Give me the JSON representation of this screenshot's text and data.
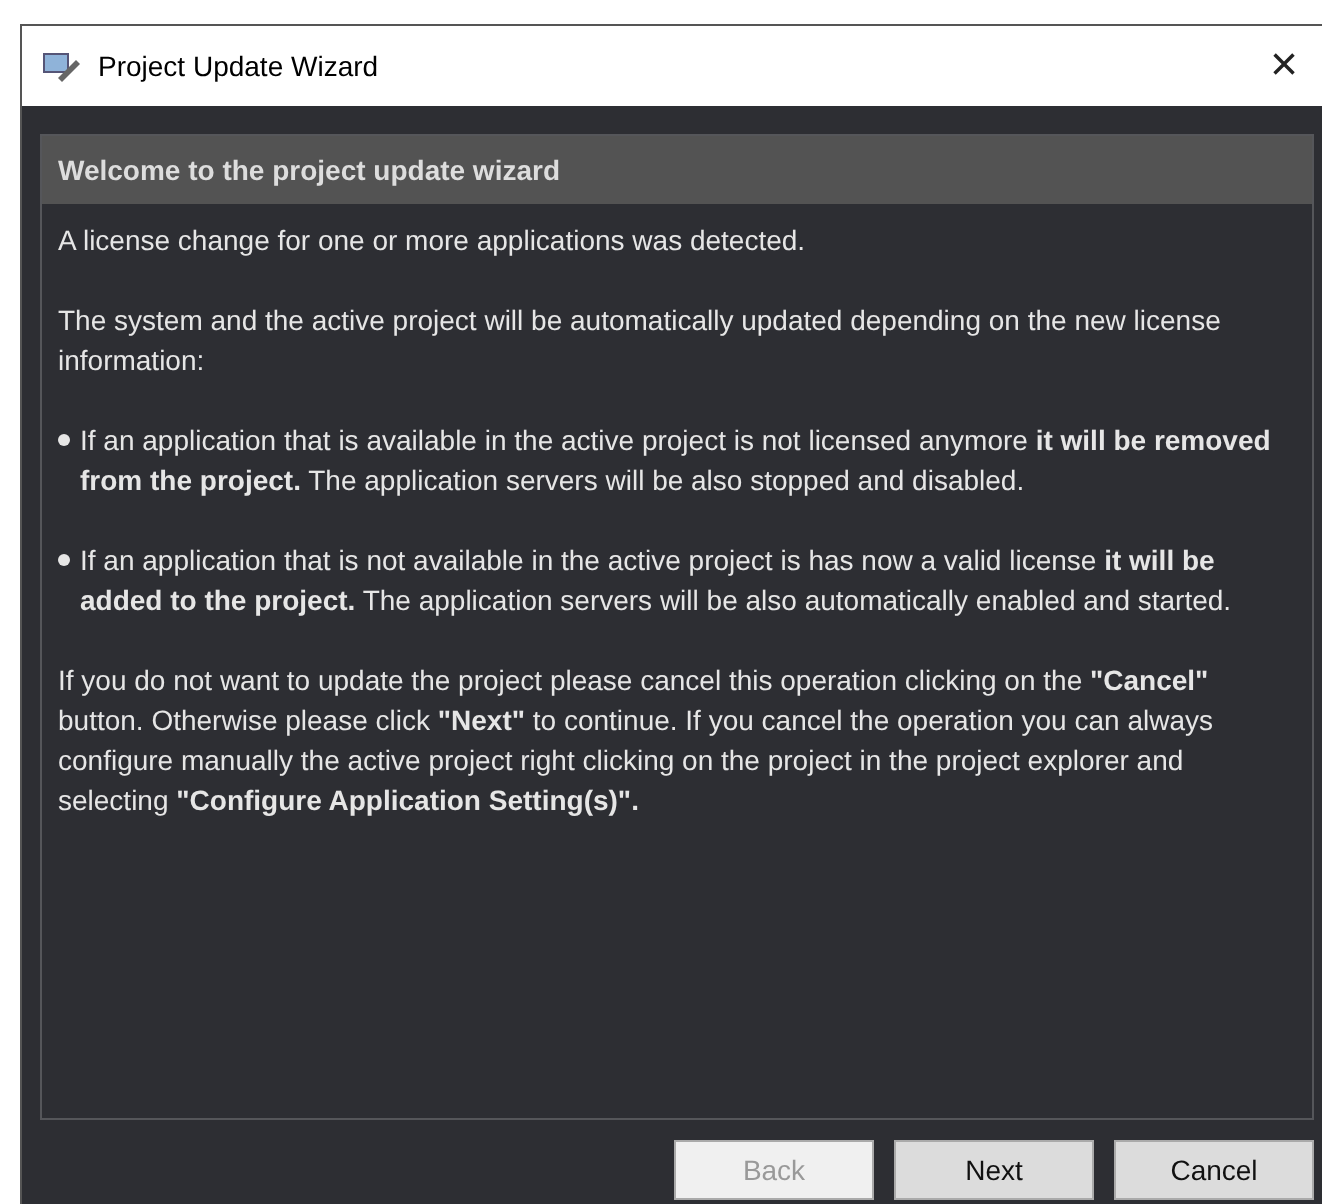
{
  "window": {
    "title": "Project Update Wizard",
    "close": "×"
  },
  "panel": {
    "header": "Welcome to the project update wizard",
    "paragraphs": [
      "A license change for one or more applications was detected.",
      "The system and the active project will be automatically updated depending on the new license information:"
    ],
    "bullets": [
      "If an application that is available in the active project is not licensed anymore **it will be removed from the project.** The application servers will be also stopped and disabled.",
      "If an application that is not available in the active project is has now a valid license **it will be added to the project.** The application servers will be also automatically enabled and started."
    ],
    "footer": "If you do not want to update the project please cancel this operation clicking on the **\"Cancel\"** button. Otherwise please click **\"Next\"** to continue.  If you cancel the operation you can always configure manually the active project right clicking on the project in the project explorer and selecting  **\"Configure Application Setting(s)\".**"
  },
  "buttons": [
    {
      "label": "Back",
      "disabled": true
    },
    {
      "label": "Next",
      "disabled": false
    },
    {
      "label": "Cancel",
      "disabled": false
    }
  ]
}
